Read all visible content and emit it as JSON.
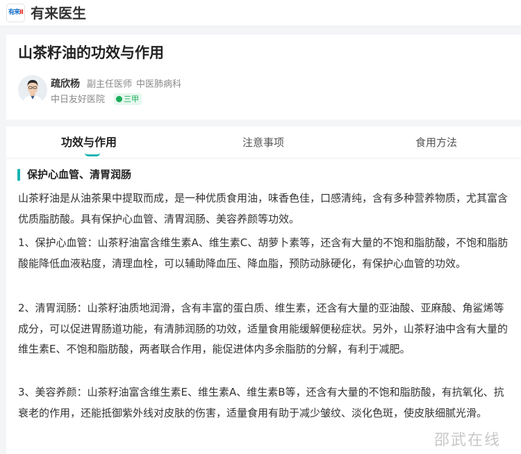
{
  "header": {
    "logo_text_blue": "有来",
    "logo_text_red": "Ⅱ",
    "brand": "有来医生"
  },
  "article": {
    "title": "山茶籽油的功效与作用"
  },
  "doctor": {
    "name": "疏欣杨",
    "title": "副主任医师",
    "department": "中医肺病科",
    "hospital": "中日友好医院",
    "level": "三甲"
  },
  "tabs": [
    {
      "label": "功效与作用",
      "active": true
    },
    {
      "label": "注意事项",
      "active": false
    },
    {
      "label": "食用方法",
      "active": false
    }
  ],
  "section": {
    "title": "保护心血管、清胃润肠",
    "paragraphs": [
      "山茶籽油是从油茶果中提取而成，是一种优质食用油，味香色佳，口感清纯，含有多种营养物质，尤其富含优质脂肪酸。具有保护心血管、清胃润肠、美容养颜等功效。",
      "1、保护心血管：山茶籽油富含维生素A、维生素C、胡萝卜素等，还含有大量的不饱和脂肪酸，不饱和脂肪酸能降低血液粘度，清理血栓，可以辅助降血压、降血脂，预防动脉硬化，有保护心血管的功效。",
      "2、清胃润肠：山茶籽油质地润滑，含有丰富的蛋白质、维生素，还含有大量的亚油酸、亚麻酸、角鲨烯等成分，可以促进胃肠道功能，有清肺润肠的功效，适量食用能缓解便秘症状。另外，山茶籽油中含有大量的维生素E、不饱和脂肪酸，两者联合作用，能促进体内多余脂肪的分解，有利于减肥。",
      "3、美容养颜：山茶籽油富含维生素E、维生素A、维生素B等，还含有大量的不饱和脂肪酸，有抗氧化、抗衰老的作用，还能抵御紫外线对皮肤的伤害，适量食用有助于减少皱纹、淡化色斑，使皮肤细腻光滑。"
    ]
  },
  "watermark": "邵武在线",
  "colors": {
    "accent": "#17b4b2",
    "badge_green": "#1aad5a",
    "logo_blue": "#1a73c8",
    "logo_red": "#e0302a"
  }
}
